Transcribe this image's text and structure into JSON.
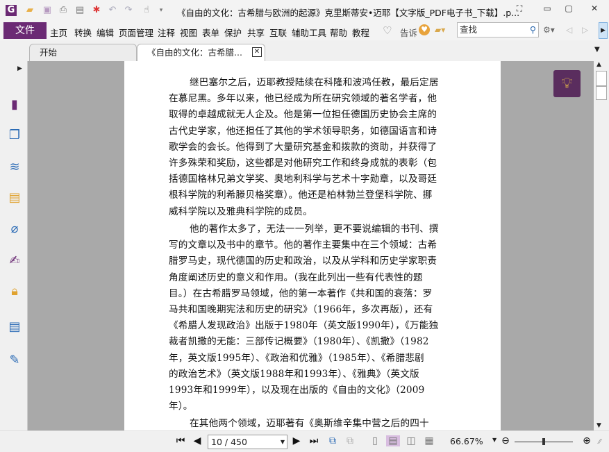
{
  "window": {
    "title": "《自由的文化：古希腊与欧洲的起源》克里斯蒂安•迈耶【文字版_PDF电子书_下载】.p..."
  },
  "menubar": {
    "file": "文件",
    "items": [
      "主页",
      "转换",
      "编辑",
      "页面管理",
      "注释",
      "视图",
      "表单",
      "保护",
      "共享",
      "互联",
      "辅助工具",
      "帮助",
      "教程"
    ],
    "tell": "告诉",
    "search_placeholder": "查找"
  },
  "tabs": [
    {
      "label": "开始"
    },
    {
      "label": "《自由的文化：古希腊..."
    }
  ],
  "document": {
    "paragraphs": [
      [
        "继巴塞尔之后，迈耶教授陆续在科隆和波鸿任教，最后定居",
        "在慕尼黑。多年以来，他已经成为所在研究领域的著名学者，他",
        "取得的卓越成就无人企及。他是第一位担任德国历史协会主席的",
        "古代史学家，他还担任了其他的学术领导职务，如德国语言和诗",
        "歌学会的会长。他得到了大量研究基金和拨款的资助，并获得了",
        "许多殊荣和奖励，这些都是对他研究工作和终身成就的表彰（包",
        "括德国格林兄弟文学奖、奥地利科学与艺术十字勋章，以及哥廷",
        "根科学院的利希滕贝格奖章）。他还是柏林勃兰登堡科学院、挪",
        "威科学院以及雅典科学院的成员。"
      ],
      [
        "他的著作太多了，无法一一列举，更不要说编辑的书刊、撰",
        "写的文章以及书中的章节。他的著作主要集中在三个领域：古希",
        "腊罗马史，现代德国的历史和政治，以及从学科和历史学家职责",
        "角度阐述历史的意义和作用。（我在此列出一些有代表性的题",
        "目。）在古希腊罗马领域，他的第一本著作《共和国的衰落：罗",
        "马共和国晚期宪法和历史的研究》（1966年，多次再版），还有",
        "《希腊人发现政治》出版于1980年（英文版1990年），《万能独",
        "裁者凯撒的无能：三部传记概要》（1980年）、《凯撒》（1982",
        "年，英文版1995年）、《政治和优雅》（1985年）、《希腊悲剧",
        "的政治艺术》（英文版1988年和1993年）、《雅典》（英文版",
        "1993年和1999年），以及现在出版的《自由的文化》（2009",
        "年）。"
      ],
      [
        "在其他两个领域，迈耶著有《奥斯维辛集中营之后的四十"
      ]
    ]
  },
  "statusbar": {
    "page": "10 / 450",
    "zoom": "66.67%",
    "zoom_fraction": 0.5
  },
  "colors": {
    "accent": "#6b2a74",
    "bulb_bg": "#5a2d5e"
  }
}
